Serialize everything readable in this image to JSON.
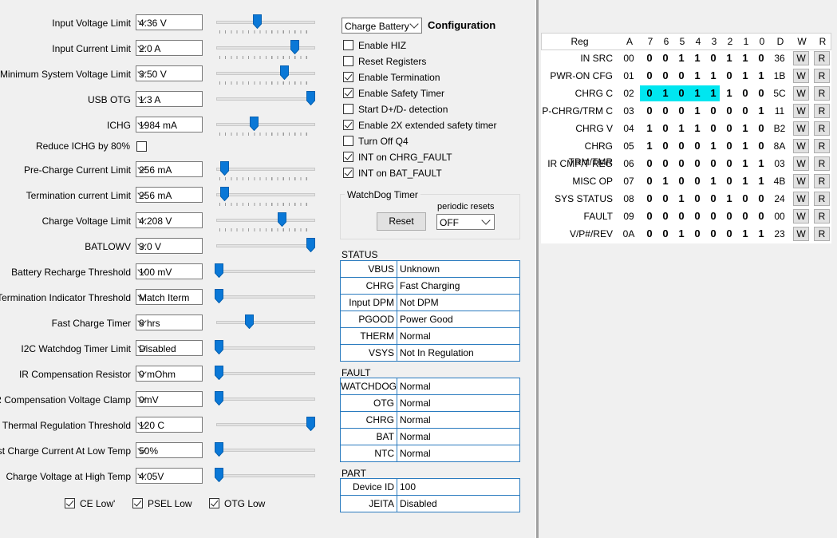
{
  "settings": [
    {
      "label": "Input Voltage Limit",
      "value": "4.36 V",
      "level": 0.42,
      "ticks": true
    },
    {
      "label": "Input Current Limit",
      "value": "2.0 A",
      "level": 0.83,
      "ticks": true
    },
    {
      "label": "Minimum System Voltage Limit",
      "value": "3.50 V",
      "level": 0.71,
      "ticks": true
    },
    {
      "label": "USB OTG",
      "value": "1.3 A",
      "level": 1.0,
      "ticks": false
    },
    {
      "label": "ICHG",
      "value": "1984 mA",
      "level": 0.38,
      "ticks": true
    },
    {
      "label": "Pre-Charge Current Limit",
      "value": "256 mA",
      "level": 0.06,
      "ticks": true
    },
    {
      "label": "Termination current Limit",
      "value": "256 mA",
      "level": 0.06,
      "ticks": true
    },
    {
      "label": "Charge Voltage Limit",
      "value": "4.208 V",
      "level": 0.69,
      "ticks": true
    },
    {
      "label": "BATLOWV",
      "value": "3.0 V",
      "level": 1.0,
      "ticks": false
    },
    {
      "label": "Battery Recharge Threshold",
      "value": "100 mV",
      "level": 0.0,
      "ticks": false
    },
    {
      "label": "Termination Indicator Threshold",
      "value": "Match Iterm",
      "level": 0.0,
      "ticks": false
    },
    {
      "label": "Fast Charge Timer",
      "value": "8 hrs",
      "level": 0.33,
      "ticks": false
    },
    {
      "label": "I2C Watchdog Timer Limit",
      "value": "Disabled",
      "level": 0.0,
      "ticks": false
    },
    {
      "label": "IR Compensation Resistor",
      "value": "0 mOhm",
      "level": 0.0,
      "ticks": false
    },
    {
      "label": "IR Compensation Voltage Clamp",
      "value": "0mV",
      "level": 0.0,
      "ticks": false
    },
    {
      "label": "Thermal Regulation Threshold",
      "value": "120 C",
      "level": 1.0,
      "ticks": false
    },
    {
      "label": "Fast Charge Current At Low Temp",
      "value": "50%",
      "level": 0.0,
      "ticks": false
    },
    {
      "label": "Charge Voltage at High Temp",
      "value": "4.05V",
      "level": 0.0,
      "ticks": false
    }
  ],
  "reduce_ichg": {
    "label": "Reduce ICHG by 80%",
    "checked": false
  },
  "bottom_checks": [
    {
      "label": "CE Low'",
      "checked": true
    },
    {
      "label": "PSEL Low",
      "checked": true
    },
    {
      "label": "OTG Low",
      "checked": true
    }
  ],
  "config": {
    "mode_value": "Charge Battery",
    "title": "Configuration",
    "items": [
      {
        "label": "Enable HIZ",
        "checked": false
      },
      {
        "label": "Reset Registers",
        "checked": false
      },
      {
        "label": "Enable Termination",
        "checked": true
      },
      {
        "label": "Enable Safety Timer",
        "checked": true
      },
      {
        "label": "Start D+/D- detection",
        "checked": false
      },
      {
        "label": "Enable 2X extended safety timer",
        "checked": true
      },
      {
        "label": "Turn Off Q4",
        "checked": false
      },
      {
        "label": "INT on CHRG_FAULT",
        "checked": true
      },
      {
        "label": "INT on BAT_FAULT",
        "checked": true
      }
    ]
  },
  "watchdog": {
    "title": "WatchDog Timer",
    "reset_label": "Reset",
    "periodic_label": "periodic resets",
    "periodic_value": "OFF"
  },
  "status": {
    "title": "STATUS",
    "rows": [
      [
        "VBUS",
        "Unknown"
      ],
      [
        "CHRG",
        "Fast Charging"
      ],
      [
        "Input DPM",
        "Not DPM"
      ],
      [
        "PGOOD",
        "Power Good"
      ],
      [
        "THERM",
        "Normal"
      ],
      [
        "VSYS",
        "Not In Regulation"
      ]
    ]
  },
  "fault": {
    "title": "FAULT",
    "rows": [
      [
        "WATCHDOG",
        "Normal"
      ],
      [
        "OTG",
        "Normal"
      ],
      [
        "CHRG",
        "Normal"
      ],
      [
        "BAT",
        "Normal"
      ],
      [
        "NTC",
        "Normal"
      ]
    ]
  },
  "part": {
    "title": "PART",
    "rows": [
      [
        "Device ID",
        "100"
      ],
      [
        "JEITA",
        "Disabled"
      ]
    ]
  },
  "registers": {
    "headers": [
      "Reg",
      "A",
      "7",
      "6",
      "5",
      "4",
      "3",
      "2",
      "1",
      "0",
      "D",
      "W",
      "R"
    ],
    "write_label": "W",
    "read_label": "R",
    "highlight_color": "#00e6f0",
    "rows": [
      {
        "name": "IN SRC",
        "addr": "00",
        "bits": [
          "0",
          "0",
          "1",
          "1",
          "0",
          "1",
          "1",
          "0"
        ],
        "hex": "36",
        "hl": false
      },
      {
        "name": "PWR-ON CFG",
        "addr": "01",
        "bits": [
          "0",
          "0",
          "0",
          "1",
          "1",
          "0",
          "1",
          "1"
        ],
        "hex": "1B",
        "hl": false
      },
      {
        "name": "CHRG C",
        "addr": "02",
        "bits": [
          "0",
          "1",
          "0",
          "1",
          "1",
          "1",
          "0",
          "0"
        ],
        "hex": "5C",
        "hl": true
      },
      {
        "name": "P-CHRG/TRM C",
        "addr": "03",
        "bits": [
          "0",
          "0",
          "0",
          "1",
          "0",
          "0",
          "0",
          "1"
        ],
        "hex": "11",
        "hl": false
      },
      {
        "name": "CHRG V",
        "addr": "04",
        "bits": [
          "1",
          "0",
          "1",
          "1",
          "0",
          "0",
          "1",
          "0"
        ],
        "hex": "B2",
        "hl": false
      },
      {
        "name": "CHRG TRM/TMR",
        "addr": "05",
        "bits": [
          "1",
          "0",
          "0",
          "0",
          "1",
          "0",
          "1",
          "0"
        ],
        "hex": "8A",
        "hl": false
      },
      {
        "name": "IR CMP/T REG",
        "addr": "06",
        "bits": [
          "0",
          "0",
          "0",
          "0",
          "0",
          "0",
          "1",
          "1"
        ],
        "hex": "03",
        "hl": false
      },
      {
        "name": "MISC OP",
        "addr": "07",
        "bits": [
          "0",
          "1",
          "0",
          "0",
          "1",
          "0",
          "1",
          "1"
        ],
        "hex": "4B",
        "hl": false
      },
      {
        "name": "SYS STATUS",
        "addr": "08",
        "bits": [
          "0",
          "0",
          "1",
          "0",
          "0",
          "1",
          "0",
          "0"
        ],
        "hex": "24",
        "hl": false
      },
      {
        "name": "FAULT",
        "addr": "09",
        "bits": [
          "0",
          "0",
          "0",
          "0",
          "0",
          "0",
          "0",
          "0"
        ],
        "hex": "00",
        "hl": false
      },
      {
        "name": "V/P#/REV",
        "addr": "0A",
        "bits": [
          "0",
          "0",
          "1",
          "0",
          "0",
          "0",
          "1",
          "1"
        ],
        "hex": "23",
        "hl": false
      }
    ]
  }
}
